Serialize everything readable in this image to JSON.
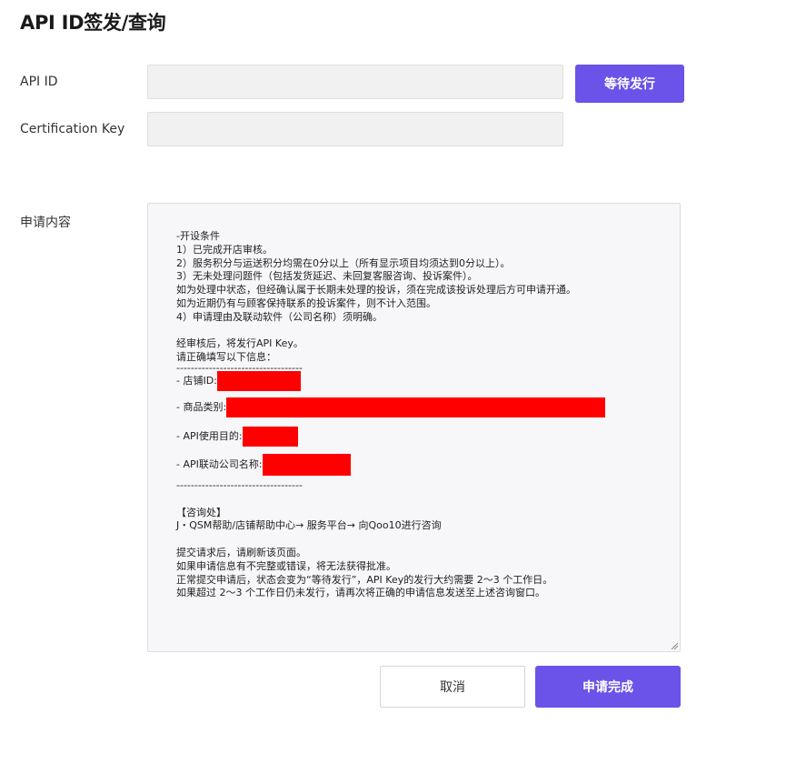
{
  "page": {
    "title": "API ID签发/查询"
  },
  "fields": {
    "api_id": {
      "label": "API ID",
      "value": "",
      "placeholder": ""
    },
    "cert_key": {
      "label": "Certification Key",
      "value": "",
      "placeholder": ""
    }
  },
  "status_button": {
    "label": "等待发行"
  },
  "application": {
    "label": "申请内容",
    "lines": {
      "l01": "-开设条件",
      "l02": "1）已完成开店审核。",
      "l03": "2）服务积分与运送积分均需在0分以上（所有显示项目均须达到0分以上）。",
      "l04": "3）无未处理问题件（包括发货延迟、未回复客服咨询、投诉案件）。",
      "l05": "如为处理中状态，但经确认属于长期未处理的投诉，须在完成该投诉处理后方可申请开通。",
      "l06": "如为近期仍有与顾客保持联系的投诉案件，则不计入范围。",
      "l07": "4）申请理由及联动软件（公司名称）须明确。",
      "l08": "经审核后，将发行API Key。",
      "l09": "请正确填写以下信息：",
      "l10": "-----------------------------------",
      "l15": "-----------------------------------",
      "l16": "【咨询处】",
      "l17": "J・QSM帮助/店铺帮助中心→ 服务平台→ 向Qoo10进行咨询",
      "l18": "提交请求后，请刷新该页面。",
      "l19": "如果申请信息有不完整或错误，将无法获得批准。",
      "l20": "正常提交申请后，状态会变为“等待发行”，API Key的发行大约需要 2〜3 个工作日。",
      "l21": "如果超过 2〜3 个工作日仍未发行，请再次将正确的申请信息发送至上述咨询窗口。"
    },
    "form_fields": {
      "shop_id": "- 店铺ID:",
      "category": "- 商品类别:",
      "purpose": "- API使用目的:",
      "company": "- API联动公司名称:"
    },
    "redaction_color": "#ff0000"
  },
  "actions": {
    "cancel": "取消",
    "submit": "申请完成"
  },
  "colors": {
    "accent": "#6b52e8",
    "input_bg": "#f1f1f2",
    "textarea_bg": "#f7f7f9"
  }
}
